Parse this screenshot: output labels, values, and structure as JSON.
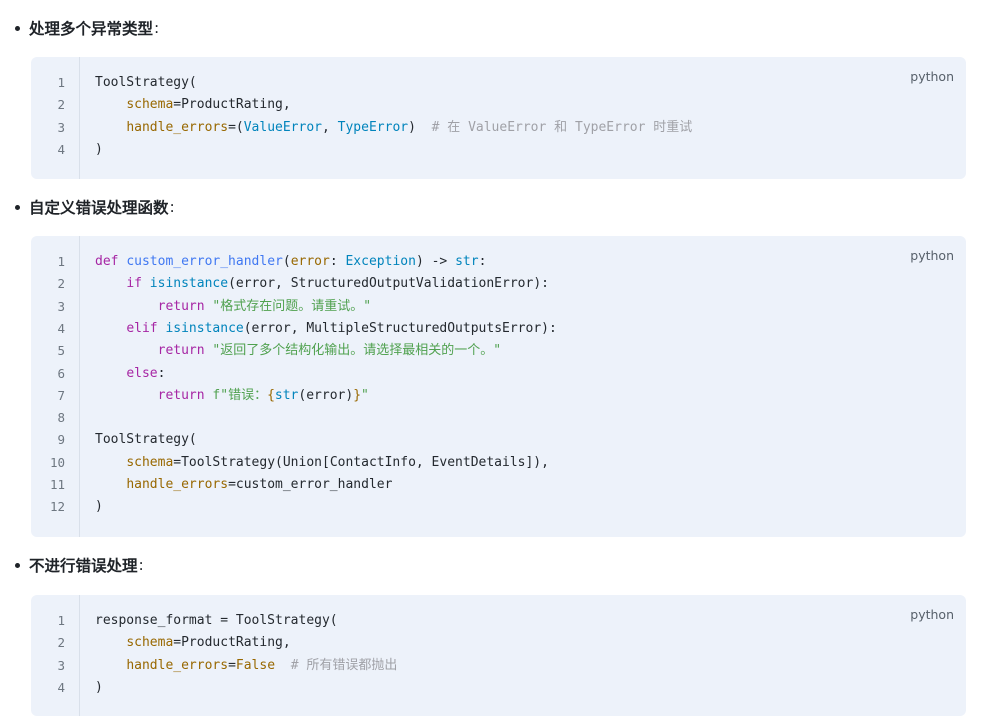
{
  "sections": [
    {
      "title": "处理多个异常类型",
      "colon": ":",
      "language": "python",
      "lines": [
        {
          "n": "1",
          "tokens": [
            {
              "t": "ToolStrategy(",
              "c": ""
            }
          ]
        },
        {
          "n": "2",
          "tokens": [
            {
              "t": "    ",
              "c": ""
            },
            {
              "t": "schema",
              "c": "pa"
            },
            {
              "t": "=ProductRating,",
              "c": ""
            }
          ]
        },
        {
          "n": "3",
          "tokens": [
            {
              "t": "    ",
              "c": ""
            },
            {
              "t": "handle_errors",
              "c": "pa"
            },
            {
              "t": "=(",
              "c": ""
            },
            {
              "t": "ValueError",
              "c": "bi"
            },
            {
              "t": ", ",
              "c": ""
            },
            {
              "t": "TypeError",
              "c": "bi"
            },
            {
              "t": ")  ",
              "c": ""
            },
            {
              "t": "# 在 ValueError 和 TypeError 时重试",
              "c": "cm"
            }
          ]
        },
        {
          "n": "4",
          "tokens": [
            {
              "t": ")",
              "c": ""
            }
          ]
        }
      ]
    },
    {
      "title": "自定义错误处理函数",
      "colon": ":",
      "language": "python",
      "lines": [
        {
          "n": "1",
          "tokens": [
            {
              "t": "def ",
              "c": "kw"
            },
            {
              "t": "custom_error_handler",
              "c": "fn"
            },
            {
              "t": "(",
              "c": ""
            },
            {
              "t": "error",
              "c": "pa"
            },
            {
              "t": ": ",
              "c": ""
            },
            {
              "t": "Exception",
              "c": "bi"
            },
            {
              "t": ") -> ",
              "c": ""
            },
            {
              "t": "str",
              "c": "bi"
            },
            {
              "t": ":",
              "c": ""
            }
          ]
        },
        {
          "n": "2",
          "tokens": [
            {
              "t": "    ",
              "c": ""
            },
            {
              "t": "if ",
              "c": "kw"
            },
            {
              "t": "isinstance",
              "c": "bi"
            },
            {
              "t": "(error, StructuredOutputValidationError):",
              "c": ""
            }
          ]
        },
        {
          "n": "3",
          "tokens": [
            {
              "t": "        ",
              "c": ""
            },
            {
              "t": "return ",
              "c": "kw"
            },
            {
              "t": "\"格式存在问题。请重试。\"",
              "c": "st"
            }
          ]
        },
        {
          "n": "4",
          "tokens": [
            {
              "t": "    ",
              "c": ""
            },
            {
              "t": "elif ",
              "c": "kw"
            },
            {
              "t": "isinstance",
              "c": "bi"
            },
            {
              "t": "(error, MultipleStructuredOutputsError):",
              "c": ""
            }
          ]
        },
        {
          "n": "5",
          "tokens": [
            {
              "t": "        ",
              "c": ""
            },
            {
              "t": "return ",
              "c": "kw"
            },
            {
              "t": "\"返回了多个结构化输出。请选择最相关的一个。\"",
              "c": "st"
            }
          ]
        },
        {
          "n": "6",
          "tokens": [
            {
              "t": "    ",
              "c": ""
            },
            {
              "t": "else",
              "c": "kw"
            },
            {
              "t": ":",
              "c": ""
            }
          ]
        },
        {
          "n": "7",
          "tokens": [
            {
              "t": "        ",
              "c": ""
            },
            {
              "t": "return ",
              "c": "kw"
            },
            {
              "t": "f\"错误：",
              "c": "st"
            },
            {
              "t": "{",
              "c": "pa"
            },
            {
              "t": "str",
              "c": "bi"
            },
            {
              "t": "(error)",
              "c": ""
            },
            {
              "t": "}",
              "c": "pa"
            },
            {
              "t": "\"",
              "c": "st"
            }
          ]
        },
        {
          "n": "8",
          "tokens": []
        },
        {
          "n": "9",
          "tokens": [
            {
              "t": "ToolStrategy(",
              "c": ""
            }
          ]
        },
        {
          "n": "10",
          "tokens": [
            {
              "t": "    ",
              "c": ""
            },
            {
              "t": "schema",
              "c": "pa"
            },
            {
              "t": "=ToolStrategy(Union[ContactInfo, EventDetails]),",
              "c": ""
            }
          ]
        },
        {
          "n": "11",
          "tokens": [
            {
              "t": "    ",
              "c": ""
            },
            {
              "t": "handle_errors",
              "c": "pa"
            },
            {
              "t": "=custom_error_handler",
              "c": ""
            }
          ]
        },
        {
          "n": "12",
          "tokens": [
            {
              "t": ")",
              "c": ""
            }
          ]
        }
      ]
    },
    {
      "title": "不进行错误处理",
      "colon": ":",
      "language": "python",
      "lines": [
        {
          "n": "1",
          "tokens": [
            {
              "t": "response_format = ToolStrategy(",
              "c": ""
            }
          ]
        },
        {
          "n": "2",
          "tokens": [
            {
              "t": "    ",
              "c": ""
            },
            {
              "t": "schema",
              "c": "pa"
            },
            {
              "t": "=ProductRating,",
              "c": ""
            }
          ]
        },
        {
          "n": "3",
          "tokens": [
            {
              "t": "    ",
              "c": ""
            },
            {
              "t": "handle_errors",
              "c": "pa"
            },
            {
              "t": "=",
              "c": ""
            },
            {
              "t": "False",
              "c": "bo"
            },
            {
              "t": "  ",
              "c": ""
            },
            {
              "t": "# 所有错误都抛出",
              "c": "cm"
            }
          ]
        },
        {
          "n": "4",
          "tokens": [
            {
              "t": ")",
              "c": ""
            }
          ]
        }
      ]
    }
  ]
}
